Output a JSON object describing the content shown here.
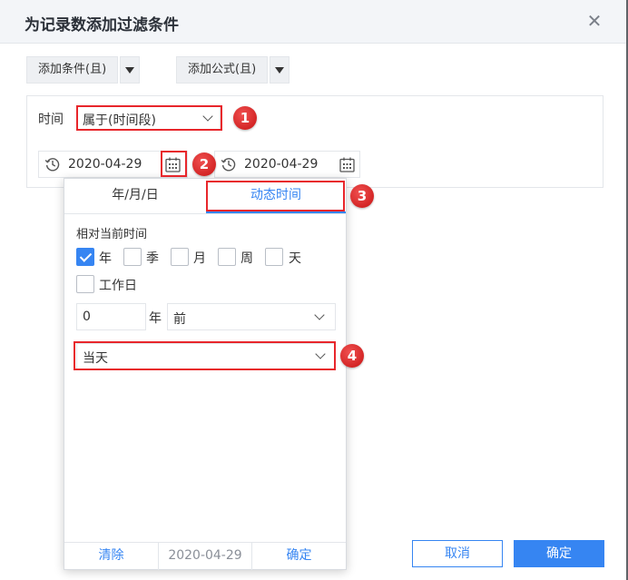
{
  "dialog": {
    "title": "为记录数添加过滤条件",
    "close_icon": "close-icon"
  },
  "toolbar": {
    "add_condition_label": "添加条件(且)",
    "add_formula_label": "添加公式(且)",
    "dropdown_icon": "caret-down-icon"
  },
  "filter": {
    "field_label": "时间",
    "operator_value": "属于(时间段)",
    "start_date": "2020-04-29",
    "end_date": "2020-04-29"
  },
  "picker": {
    "tabs": [
      "年/月/日",
      "动态时间"
    ],
    "active_tab": "动态时间",
    "relative_label": "相对当前时间",
    "units": [
      {
        "label": "年",
        "checked": true
      },
      {
        "label": "季",
        "checked": false
      },
      {
        "label": "月",
        "checked": false
      },
      {
        "label": "周",
        "checked": false
      },
      {
        "label": "天",
        "checked": false
      },
      {
        "label": "工作日",
        "checked": false
      }
    ],
    "offset_value": "0",
    "offset_unit": "年",
    "direction_value": "前",
    "day_value": "当天",
    "footer": {
      "clear_label": "清除",
      "current_date": "2020-04-29",
      "confirm_label": "确定"
    }
  },
  "annotations": [
    "1",
    "2",
    "3",
    "4"
  ],
  "footer": {
    "cancel_label": "取消",
    "ok_label": "确定"
  },
  "colors": {
    "accent": "#3685f2",
    "annotation_red": "#e8262b"
  }
}
